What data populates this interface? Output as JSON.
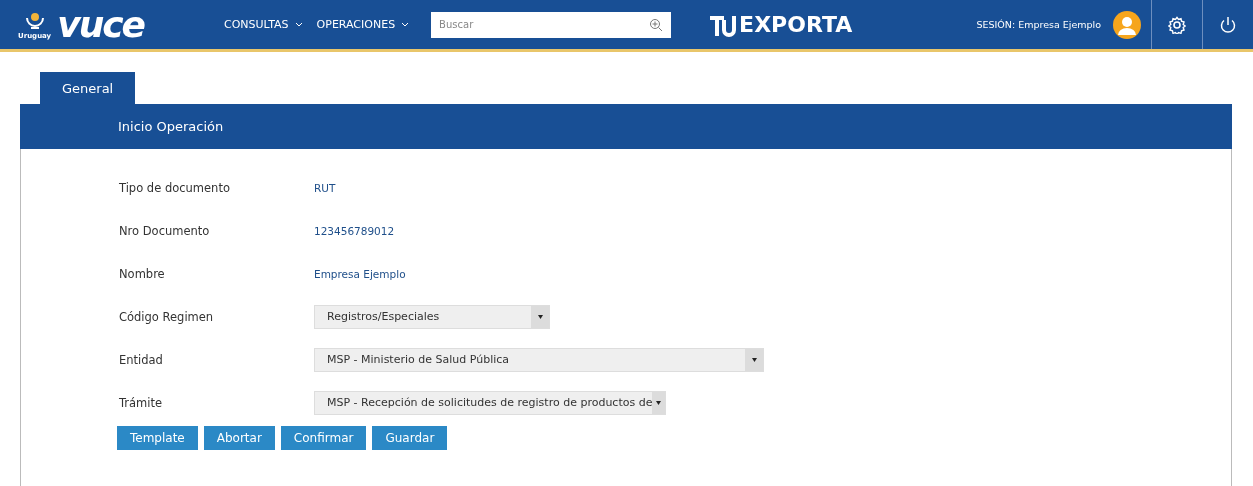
{
  "header": {
    "logo": {
      "brand": "vuce",
      "country": "Uruguay"
    },
    "menu": [
      {
        "label": "CONSULTAS"
      },
      {
        "label": "OPERACIONES"
      }
    ],
    "search": {
      "placeholder": "Buscar"
    },
    "partner_logo": "EXPORTA",
    "session": "SESIÓN: Empresa Ejemplo"
  },
  "tabs": [
    {
      "label": "General",
      "selected": true
    }
  ],
  "panel": {
    "title": "Inicio Operación",
    "fields": [
      {
        "kind": "text",
        "label": "Tipo de documento",
        "value": "RUT"
      },
      {
        "kind": "text",
        "label": "Nro Documento",
        "value": "123456789012"
      },
      {
        "kind": "text",
        "label": "Nombre",
        "value": "Empresa Ejemplo"
      },
      {
        "kind": "select",
        "label": "Código Regimen",
        "value": "Registros/Especiales"
      },
      {
        "kind": "select",
        "label": "Entidad",
        "value": "MSP - Ministerio de Salud Pública"
      },
      {
        "kind": "select",
        "label": "Trámite",
        "value": "MSP - Recepción de solicitudes de registro de productos de"
      }
    ],
    "buttons": [
      "Template",
      "Abortar",
      "Confirmar",
      "Guardar"
    ]
  }
}
